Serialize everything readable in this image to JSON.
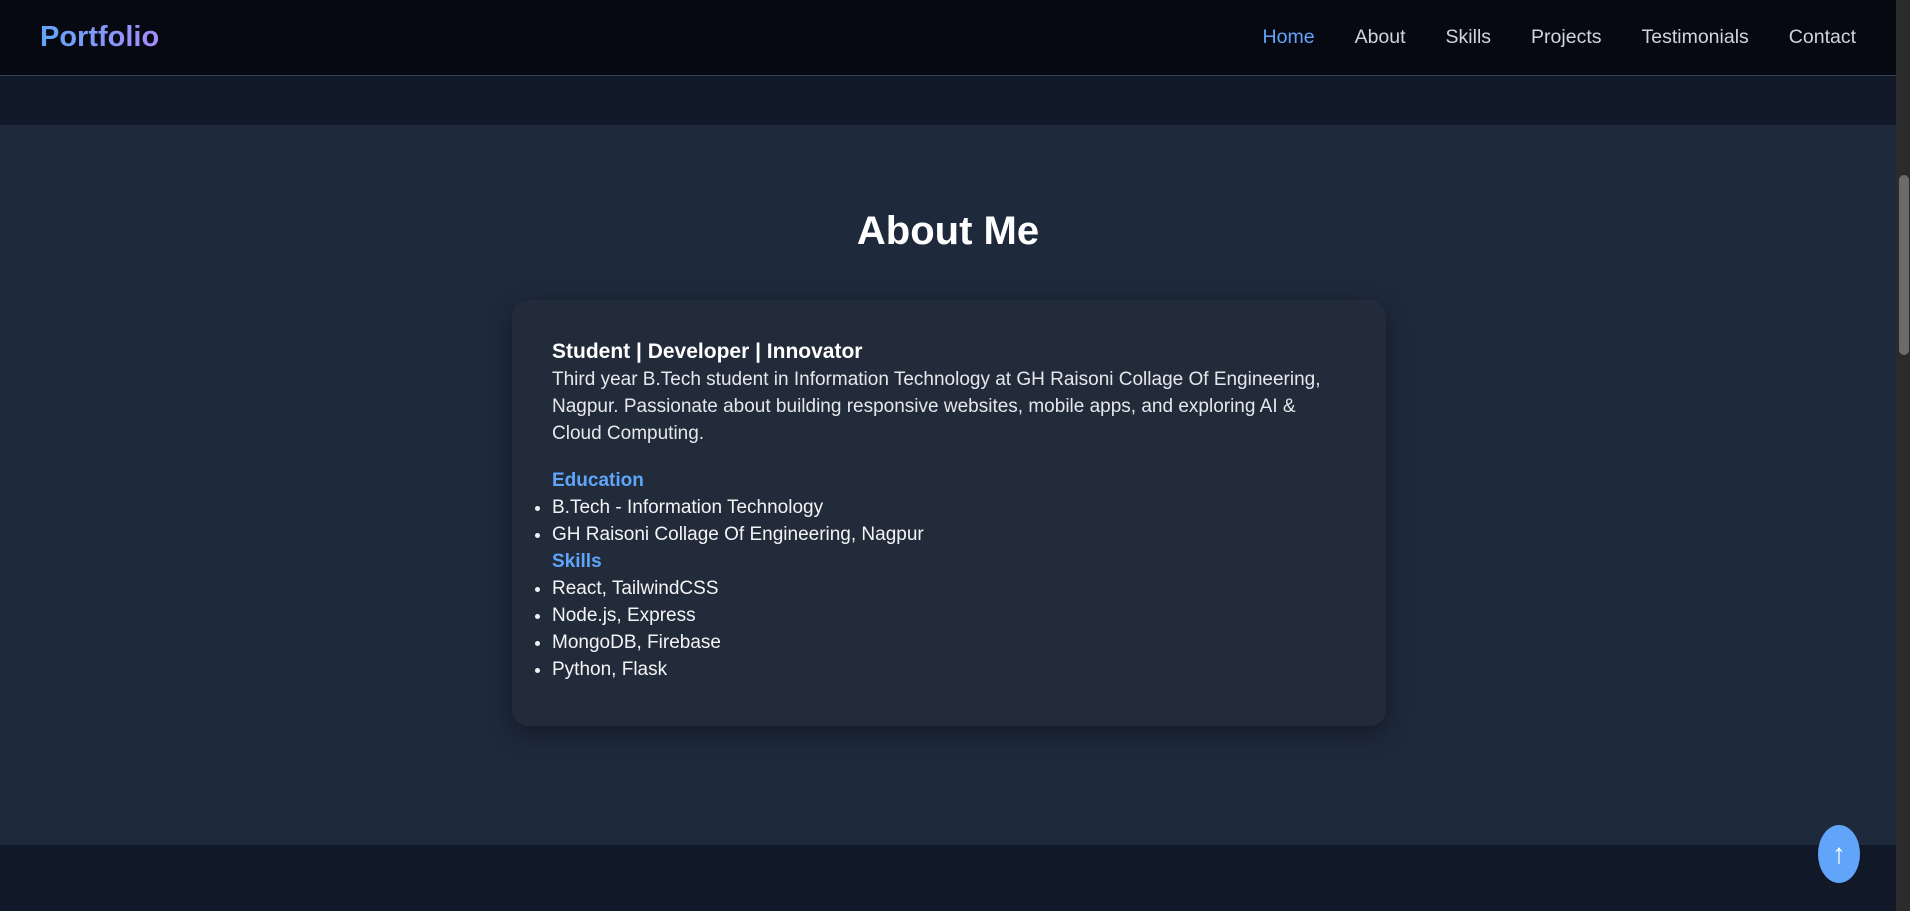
{
  "nav": {
    "logo": "Portfolio",
    "links": [
      "Home",
      "About",
      "Skills",
      "Projects",
      "Testimonials",
      "Contact"
    ],
    "active": "Home"
  },
  "about": {
    "title": "About Me",
    "tagline": "Student | Developer | Innovator",
    "bio": "Third year B.Tech student in Information Technology at GH Raisoni Collage Of Engineering, Nagpur. Passionate about building responsive websites, mobile apps, and exploring AI & Cloud Computing.",
    "education_heading": "Education",
    "education": [
      "B.Tech - Information Technology",
      "GH Raisoni Collage Of Engineering, Nagpur"
    ],
    "skills_heading": "Skills",
    "skills": [
      "React, TailwindCSS",
      "Node.js, Express",
      "MongoDB, Firebase",
      "Python, Flask"
    ]
  },
  "scroll_top": {
    "icon": "arrow-up-icon",
    "glyph": "↑"
  },
  "colors": {
    "accent": "#60a5fa",
    "nav_bg": "#060911",
    "section_bg": "#1e293b",
    "card_bg": "#222b3a"
  }
}
